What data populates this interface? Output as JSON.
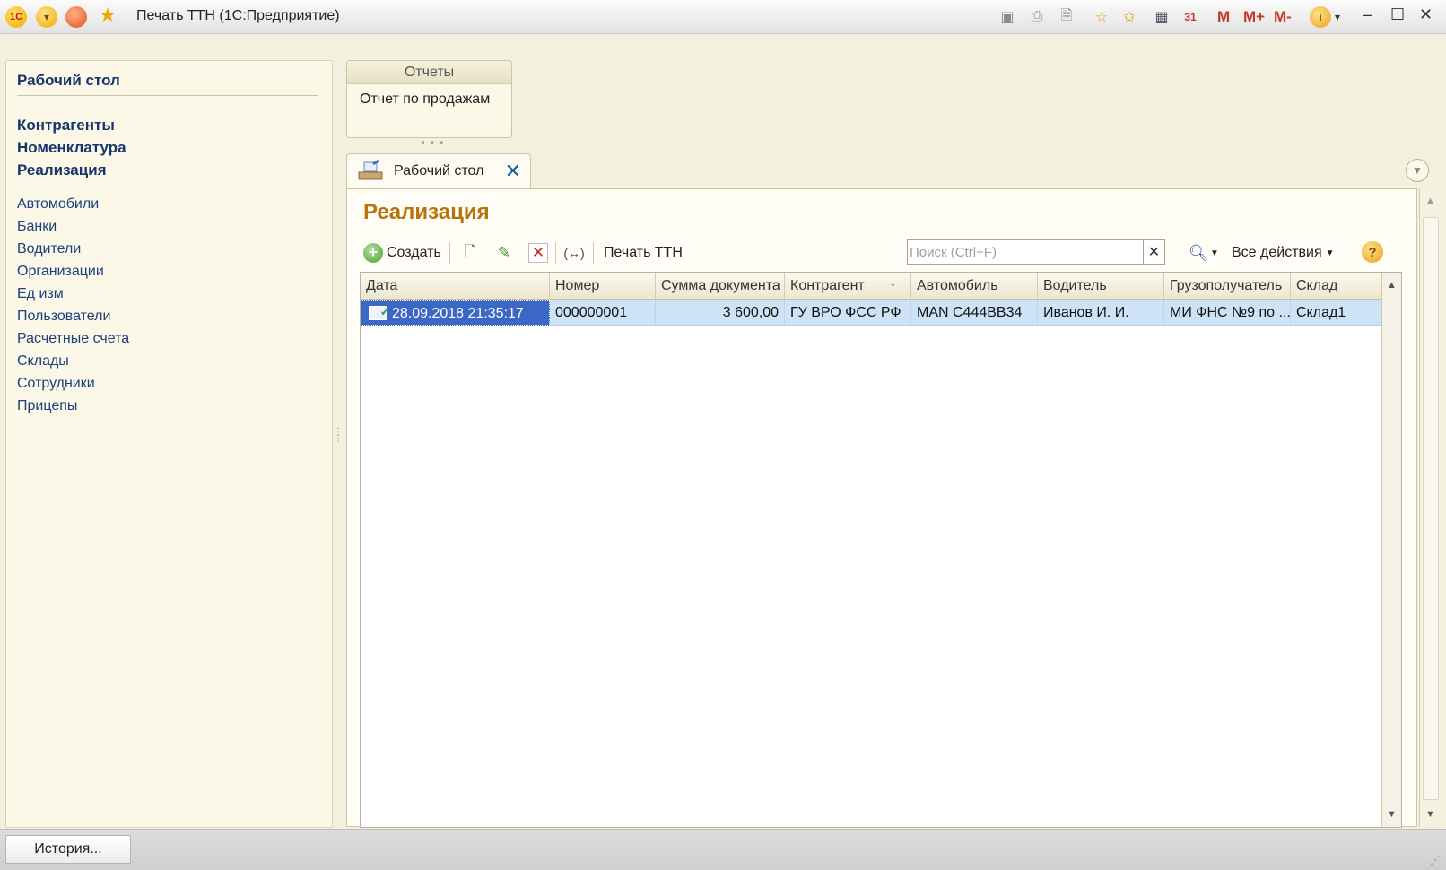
{
  "window": {
    "title": "Печать ТТН  (1С:Предприятие)",
    "logo_text": "1С",
    "memory": {
      "m": "M",
      "m_plus": "M+",
      "m_minus": "M-"
    }
  },
  "nav": {
    "home": "Рабочий стол",
    "bold_items": [
      "Контрагенты",
      "Номенклатура",
      "Реализация"
    ],
    "items": [
      "Автомобили",
      "Банки",
      "Водители",
      "Организации",
      "Ед изм",
      "Пользователи",
      "Расчетные счета",
      "Склады",
      "Сотрудники",
      "Прицепы"
    ]
  },
  "reports": {
    "header": "Отчеты",
    "link": "Отчет по продажам"
  },
  "tab": {
    "label": "Рабочий стол",
    "close": "✕"
  },
  "form": {
    "title": "Реализация",
    "toolbar": {
      "create": "Создать",
      "print_ttn": "Печать ТТН",
      "all_actions": "Все действия",
      "search_placeholder": "Поиск (Ctrl+F)",
      "search_value": ""
    }
  },
  "table": {
    "columns": [
      "Дата",
      "Номер",
      "Сумма документа",
      "Контрагент",
      "Автомобиль",
      "Водитель",
      "Грузополучатель",
      "Склад"
    ],
    "sort_indicator": "↑",
    "rows": [
      [
        "28.09.2018 21:35:17",
        "000000001",
        "3 600,00",
        "ГУ ВРО ФСС РФ",
        "MAN С444ВВ34",
        "Иванов И. И.",
        "МИ ФНС №9 по ...",
        "Склад1"
      ]
    ]
  },
  "statusbar": {
    "history": "История..."
  },
  "colors": {
    "nav_link": "#17356b",
    "form_title": "#b8730b",
    "row_selected": "#cfe3f7",
    "cell_focused": "#3b67c5",
    "background": "#f3f0dd"
  }
}
